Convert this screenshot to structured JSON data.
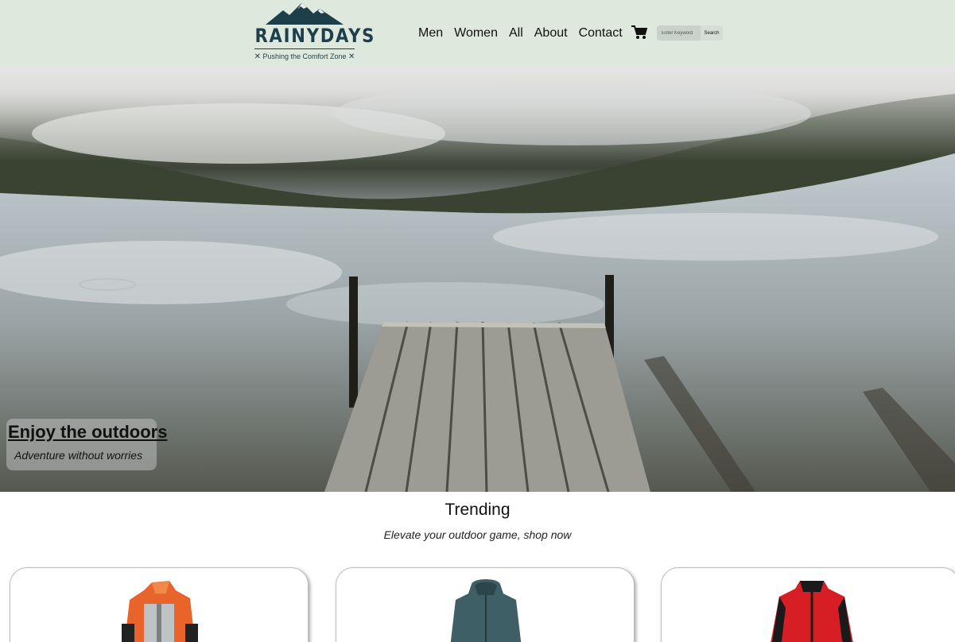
{
  "header": {
    "logo": {
      "name": "RAINYDAYS",
      "tagline": "Pushing the Comfort Zone"
    },
    "nav": [
      "Men",
      "Women",
      "All",
      "About",
      "Contact"
    ],
    "cart_icon": "cart-icon",
    "search": {
      "placeholder": "Enter Keyword",
      "button_label": "Search"
    }
  },
  "hero": {
    "title": "Enjoy the outdoors",
    "subtitle": "Adventure without worries"
  },
  "trending": {
    "title": "Trending",
    "subtitle": "Elevate your outdoor game, shop now",
    "products": [
      {
        "icon": "orange-survival-jacket-image",
        "color": "#e8642a"
      },
      {
        "icon": "teal-parka-image",
        "color": "#3f5f66"
      },
      {
        "icon": "red-cycling-jacket-image",
        "color": "#d81e25"
      }
    ]
  },
  "colors": {
    "header_bg": "#dfe8dc",
    "brand": "#1d3e4b"
  }
}
